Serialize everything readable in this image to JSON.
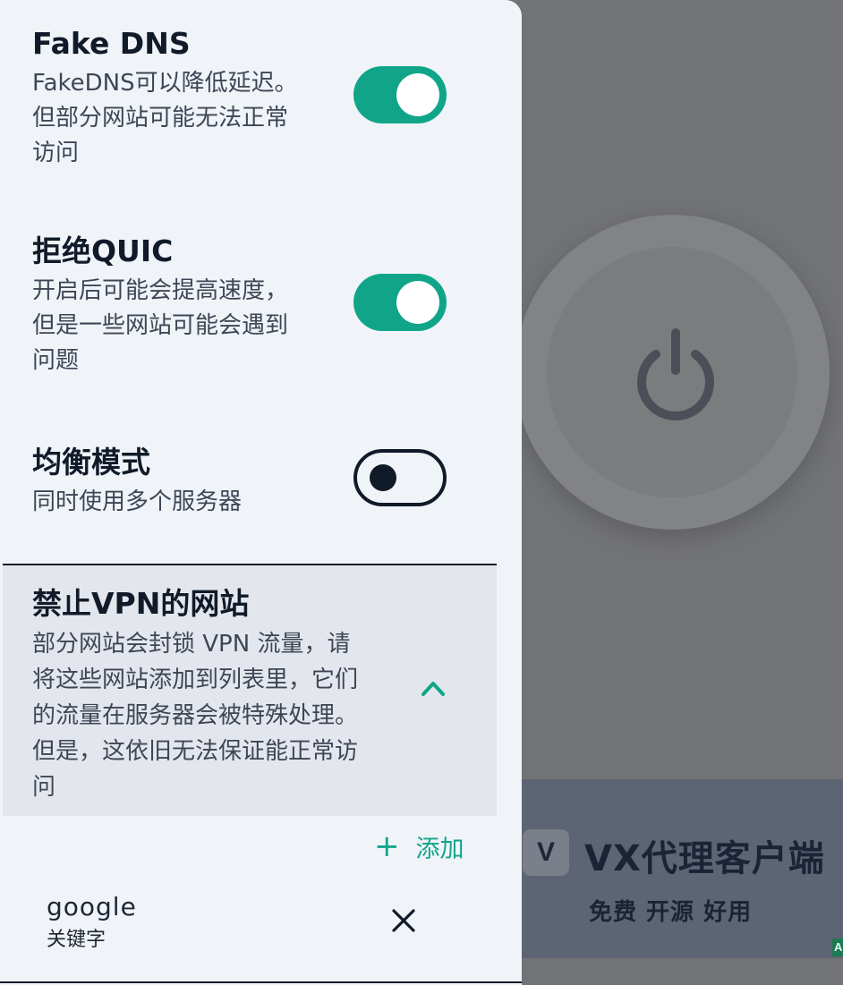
{
  "settings": {
    "fake_dns": {
      "title": "Fake DNS",
      "desc_line1": "FakeDNS可以降低延迟。",
      "desc_line2": "但部分网站可能无法正常",
      "desc_line3": "访问",
      "enabled": true
    },
    "block_quic": {
      "title": "拒绝QUIC",
      "desc_line1": "开启后可能会提高速度，",
      "desc_line2": "但是一些网站可能会遇到",
      "desc_line3": "问题",
      "enabled": true
    },
    "balance_mode": {
      "title": "均衡模式",
      "desc": "同时使用多个服务器",
      "enabled": false
    }
  },
  "blocked_sites": {
    "title": "禁止VPN的网站",
    "desc_line1": "部分网站会封锁 VPN 流量，请",
    "desc_line2": "将这些网站添加到列表里，它们",
    "desc_line3": "的流量在服务器会被特殊处理。",
    "desc_line4": "但是，这依旧无法保证能正常访",
    "desc_line5": "问",
    "expanded": true,
    "add_label": "添加",
    "entries": [
      {
        "name": "google",
        "type": "关键字"
      }
    ]
  },
  "background_app": {
    "banner": {
      "logo_letter": "V",
      "title": "VX代理客户端",
      "subtitle": "免费 开源 好用",
      "ad_badge": "A"
    }
  },
  "colors": {
    "accent": "#10a589",
    "drawer_bg": "#f0f4f9",
    "section_bg": "#e3e7ed",
    "text_primary": "#111a28",
    "scrim": "#727376"
  },
  "icons": [
    "power-icon",
    "chevron-up-icon",
    "plus-icon",
    "close-icon"
  ]
}
